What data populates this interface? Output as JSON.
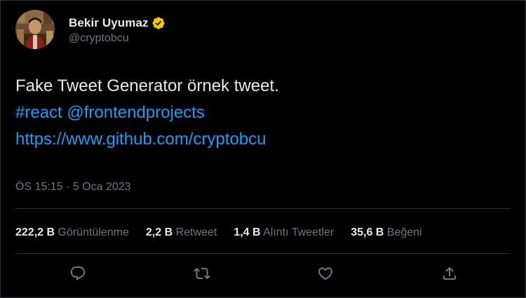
{
  "user": {
    "display_name": "Bekir Uyumaz",
    "handle": "@cryptobcu",
    "verified": true,
    "verified_color": "#f7c600"
  },
  "tweet": {
    "text_line": "Fake Tweet Generator örnek tweet.",
    "hashtag": "#react",
    "mention": "@frontendprojects",
    "url": "https://www.github.com/cryptobcu",
    "timestamp": "ÖS 15:15 · 5 Oca 2023"
  },
  "stats": [
    {
      "value": "222,2 B",
      "label": "Görüntülenme"
    },
    {
      "value": "2,2 B",
      "label": "Retweet"
    },
    {
      "value": "1,4 B",
      "label": "Alıntı Tweetler"
    },
    {
      "value": "35,6 B",
      "label": "Beğeni"
    }
  ],
  "actions": [
    {
      "icon": "reply-icon"
    },
    {
      "icon": "retweet-icon"
    },
    {
      "icon": "like-icon"
    },
    {
      "icon": "share-icon"
    }
  ],
  "colors": {
    "background": "#000000",
    "text": "#e7e9ea",
    "secondary": "#71767b",
    "link": "#1d9bf0",
    "border": "#2f3336"
  }
}
